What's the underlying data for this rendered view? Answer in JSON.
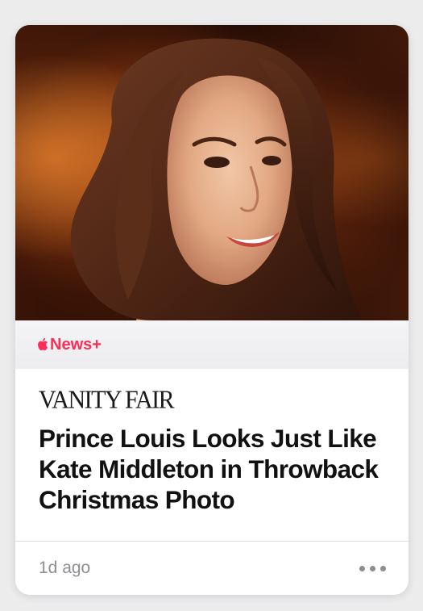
{
  "article": {
    "brand": "News+",
    "publication": "VANITY FAIR",
    "headline": "Prince Louis Looks Just Like Kate Middleton in Throwback Christmas Photo",
    "timestamp": "1d ago",
    "image_alt": "photo"
  },
  "icons": {
    "brand_logo": "apple-logo-icon",
    "more": "ellipsis-icon"
  },
  "colors": {
    "brand_accent": "#ff2d55",
    "headline": "#111111",
    "meta_gray": "#8e8e93",
    "page_background": "#ececed"
  }
}
